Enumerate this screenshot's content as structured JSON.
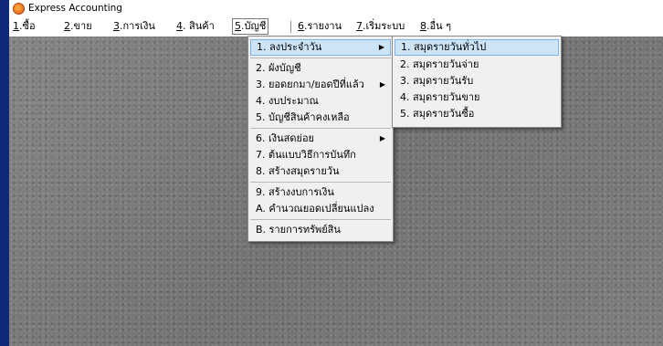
{
  "window": {
    "title": "Express Accounting"
  },
  "menubar": {
    "items": [
      {
        "acc": "1",
        "rest": ".ซื้อ"
      },
      {
        "acc": "2",
        "rest": ".ขาย"
      },
      {
        "acc": "3",
        "rest": ".การเงิน"
      },
      {
        "acc": "4",
        "rest": ". สินค้า"
      },
      {
        "acc": "5",
        "rest": ".บัญชี"
      },
      {
        "acc": "6",
        "rest": ".รายงาน"
      },
      {
        "acc": "7",
        "rest": ".เริ่มระบบ"
      },
      {
        "acc": "8",
        "rest": ".อื่น ๆ"
      }
    ]
  },
  "account_menu": {
    "items": [
      {
        "label": "1. ลงประจำวัน",
        "has_submenu": true
      },
      {
        "label": "2. ผังบัญชี",
        "has_submenu": false
      },
      {
        "label": "3. ยอดยกมา/ยอดปีที่แล้ว",
        "has_submenu": true
      },
      {
        "label": "4. งบประมาณ",
        "has_submenu": false
      },
      {
        "label": "5. บัญชีสินค้าคงเหลือ",
        "has_submenu": false
      },
      {
        "label": "6. เงินสดย่อย",
        "has_submenu": true
      },
      {
        "label": "7. ต้นแบบวิธีการบันทึก",
        "has_submenu": false
      },
      {
        "label": "8. สร้างสมุดรายวัน",
        "has_submenu": false
      },
      {
        "label": "9. สร้างงบการเงิน",
        "has_submenu": false
      },
      {
        "label": "A. คำนวณยอดเปลี่ยนแปลง",
        "has_submenu": false
      },
      {
        "label": "B. รายการทรัพย์สิน",
        "has_submenu": false
      }
    ],
    "arrow_glyph": "▶"
  },
  "daily_submenu": {
    "items": [
      "1. สมุดรายวันทั่วไป",
      "2. สมุดรายวันจ่าย",
      "3. สมุดรายวันรับ",
      "4. สมุดรายวันขาย",
      "5. สมุดรายวันซื้อ"
    ]
  },
  "colors": {
    "highlight": "#cde4f7",
    "highlight_border": "#7eb4ea",
    "workspace": "#7a7a7a",
    "left_strip": "#0e2a78"
  }
}
